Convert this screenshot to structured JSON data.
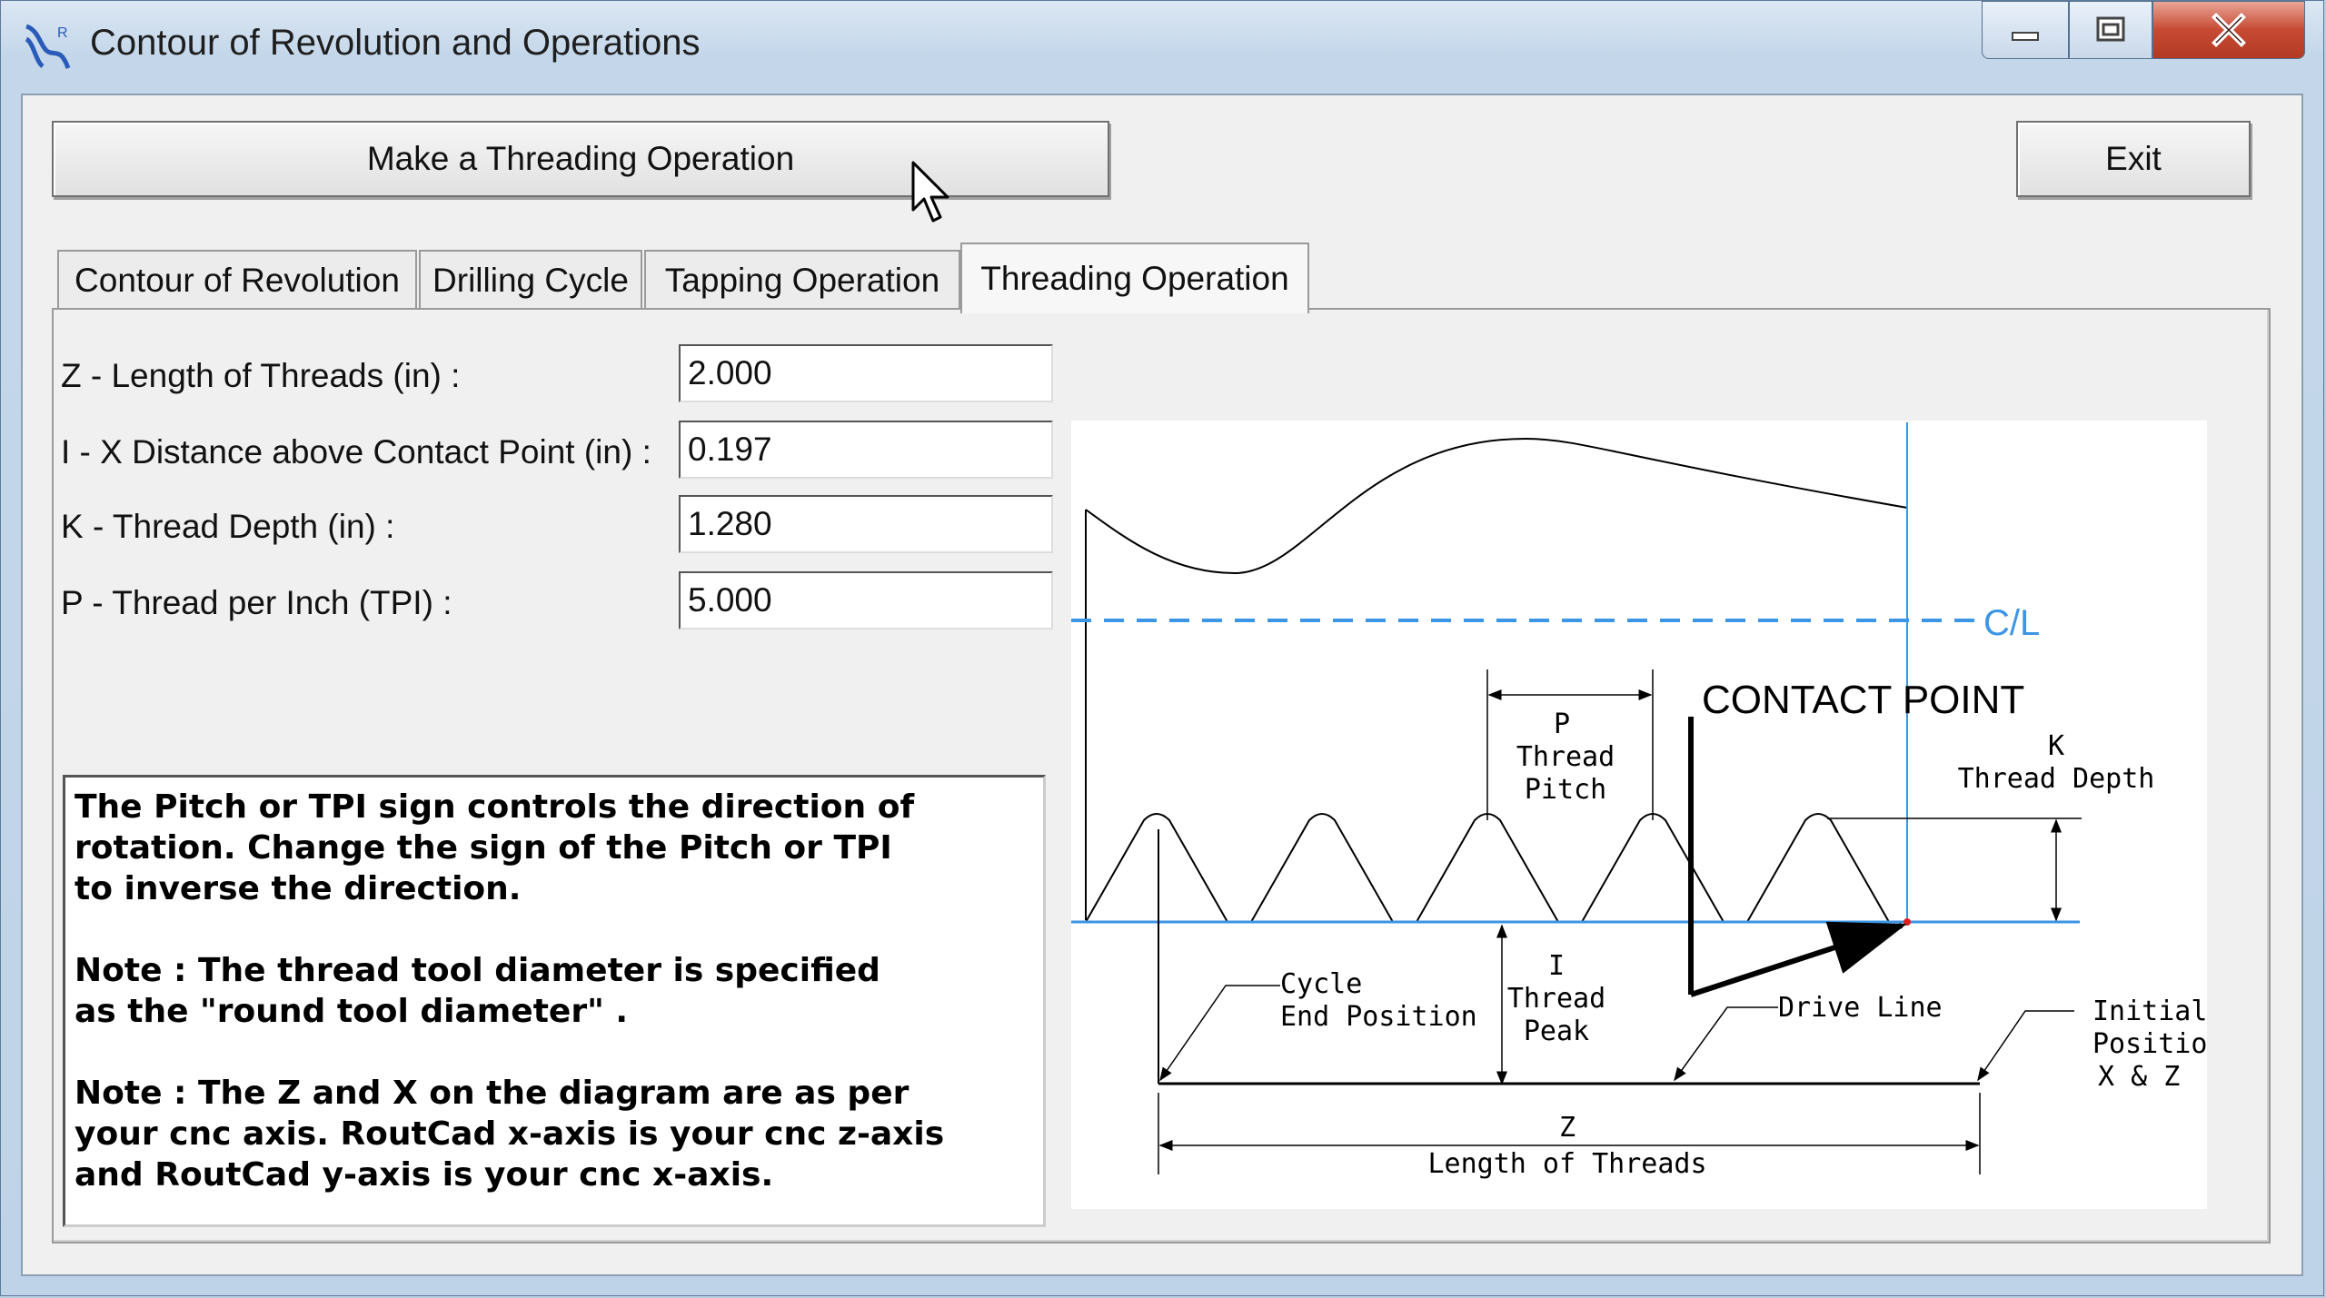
{
  "window": {
    "title": "Contour of Revolution and Operations",
    "icon": "app-logo-icon",
    "controls": [
      "minimize-icon",
      "maximize-icon",
      "close-icon"
    ]
  },
  "toolbar": {
    "make_button": "Make a Threading Operation",
    "exit_button": "Exit"
  },
  "tabs": [
    {
      "label": "Contour of Revolution"
    },
    {
      "label": "Drilling Cycle"
    },
    {
      "label": "Tapping Operation"
    },
    {
      "label": "Threading Operation",
      "active": true
    }
  ],
  "fields": [
    {
      "label": "Z - Length of Threads  (in) :",
      "value": "2.000"
    },
    {
      "label": "I - X Distance above Contact Point (in) :",
      "value": "0.197"
    },
    {
      "label": "K - Thread Depth (in) :",
      "value": "1.280"
    },
    {
      "label": "P - Thread per Inch (TPI) :",
      "value": "5.000"
    }
  ],
  "notes": {
    "p1": [
      "The Pitch or TPI sign controls the direction of",
      "rotation. Change the sign of the Pitch or TPI",
      "to inverse the direction."
    ],
    "p2": [
      "Note : The thread tool diameter is specified",
      "as the \"round tool diameter\" ."
    ],
    "p3": [
      "Note : The Z and X on the diagram are as per",
      "your cnc axis. RoutCad x-axis is your cnc z-axis",
      "and RoutCad y-axis is your cnc x-axis."
    ]
  },
  "diagram": {
    "centerline": "C/L",
    "contact_point": "CONTACT POINT",
    "p_label": [
      "P",
      "Thread",
      "Pitch"
    ],
    "k_label": [
      "K",
      "Thread Depth"
    ],
    "i_label": [
      "I",
      "Thread",
      "Peak"
    ],
    "cycle_end": [
      "Cycle",
      "End Position"
    ],
    "drive_line": "Drive Line",
    "initial_position": [
      "Initial",
      "Position",
      "X & Z"
    ],
    "z_label": [
      "Z",
      "Length of Threads"
    ],
    "colors": {
      "centerline": "#3c96e6",
      "line": "#000000"
    }
  }
}
